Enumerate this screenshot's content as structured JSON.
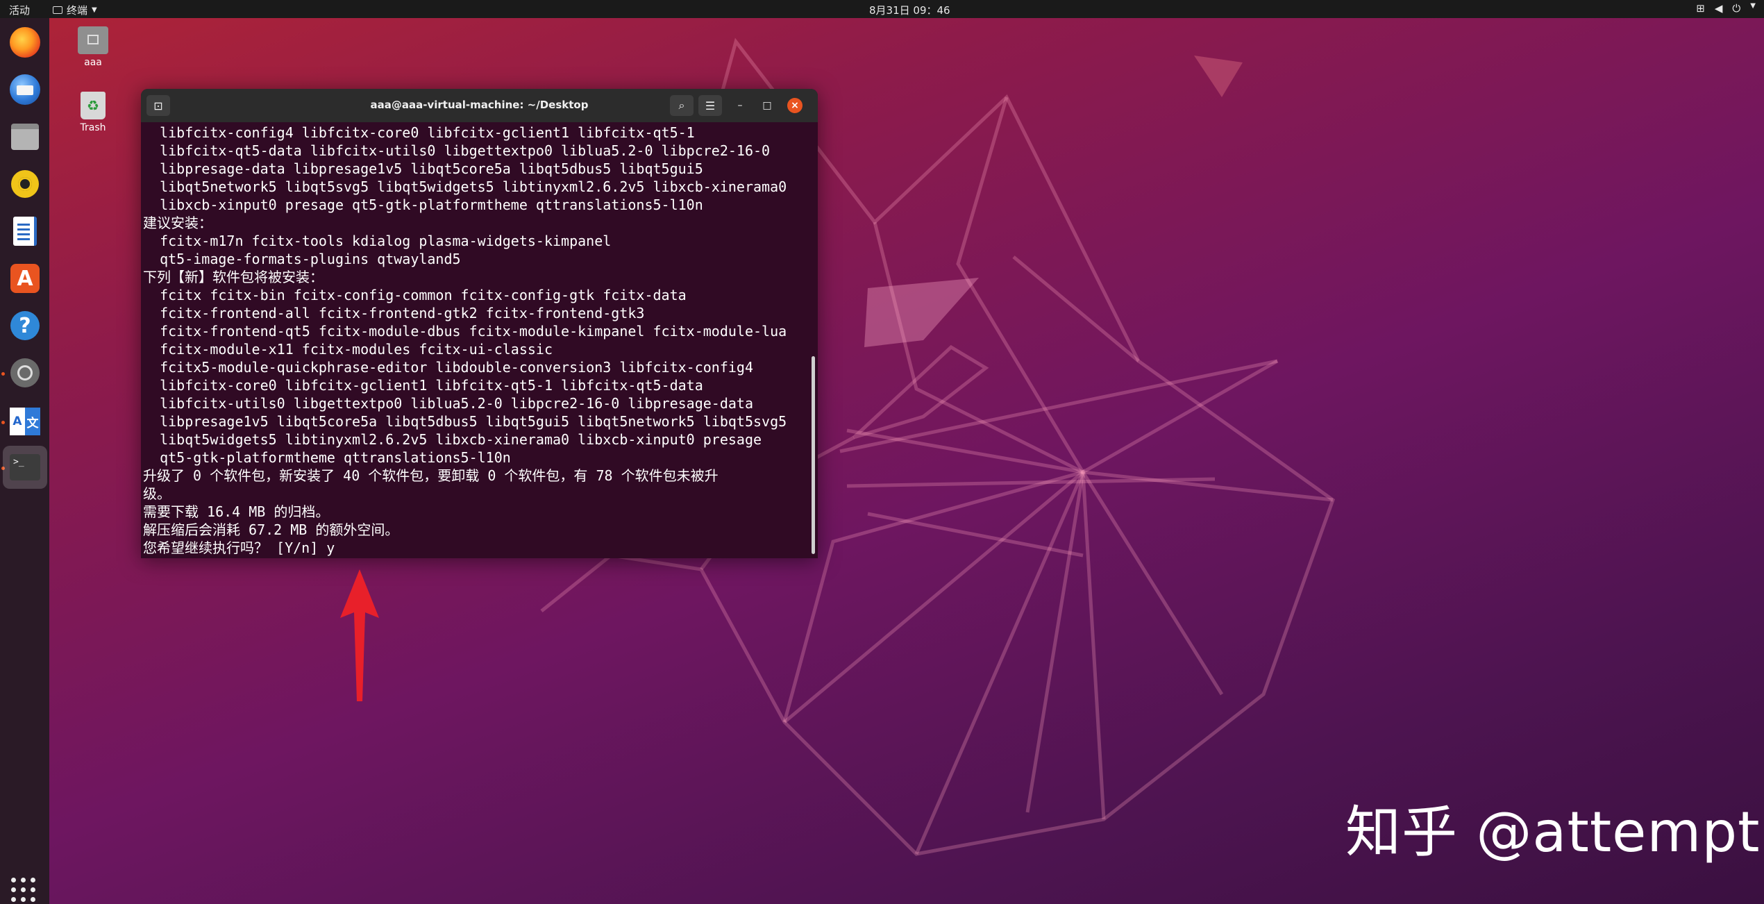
{
  "topbar": {
    "activities": "活动",
    "app_menu": "终端",
    "clock": "8月31日 09：46"
  },
  "desktop": {
    "home_label": "aaa",
    "trash_label": "Trash"
  },
  "terminal": {
    "title": "aaa@aaa-virtual-machine: ~/Desktop",
    "lines": [
      "  libfcitx-config4 libfcitx-core0 libfcitx-gclient1 libfcitx-qt5-1",
      "  libfcitx-qt5-data libfcitx-utils0 libgettextpo0 liblua5.2-0 libpcre2-16-0",
      "  libpresage-data libpresage1v5 libqt5core5a libqt5dbus5 libqt5gui5",
      "  libqt5network5 libqt5svg5 libqt5widgets5 libtinyxml2.6.2v5 libxcb-xinerama0",
      "  libxcb-xinput0 presage qt5-gtk-platformtheme qttranslations5-l10n",
      "建议安装：",
      "  fcitx-m17n fcitx-tools kdialog plasma-widgets-kimpanel",
      "  qt5-image-formats-plugins qtwayland5",
      "下列【新】软件包将被安装：",
      "  fcitx fcitx-bin fcitx-config-common fcitx-config-gtk fcitx-data",
      "  fcitx-frontend-all fcitx-frontend-gtk2 fcitx-frontend-gtk3",
      "  fcitx-frontend-qt5 fcitx-module-dbus fcitx-module-kimpanel fcitx-module-lua",
      "  fcitx-module-x11 fcitx-modules fcitx-ui-classic",
      "  fcitx5-module-quickphrase-editor libdouble-conversion3 libfcitx-config4",
      "  libfcitx-core0 libfcitx-gclient1 libfcitx-qt5-1 libfcitx-qt5-data",
      "  libfcitx-utils0 libgettextpo0 liblua5.2-0 libpcre2-16-0 libpresage-data",
      "  libpresage1v5 libqt5core5a libqt5dbus5 libqt5gui5 libqt5network5 libqt5svg5",
      "  libqt5widgets5 libtinyxml2.6.2v5 libxcb-xinerama0 libxcb-xinput0 presage",
      "  qt5-gtk-platformtheme qttranslations5-l10n",
      "升级了 0 个软件包，新安装了 40 个软件包，要卸载 0 个软件包，有 78 个软件包未被升",
      "级。",
      "需要下载 16.4 MB 的归档。",
      "解压缩后会消耗 67.2 MB 的额外空间。",
      "您希望继续执行吗？ [Y/n] y"
    ]
  },
  "watermark": "知乎 @attempt",
  "colors": {
    "accent": "#e95420",
    "terminal_bg": "#300a24",
    "arrow": "#e8202a"
  }
}
